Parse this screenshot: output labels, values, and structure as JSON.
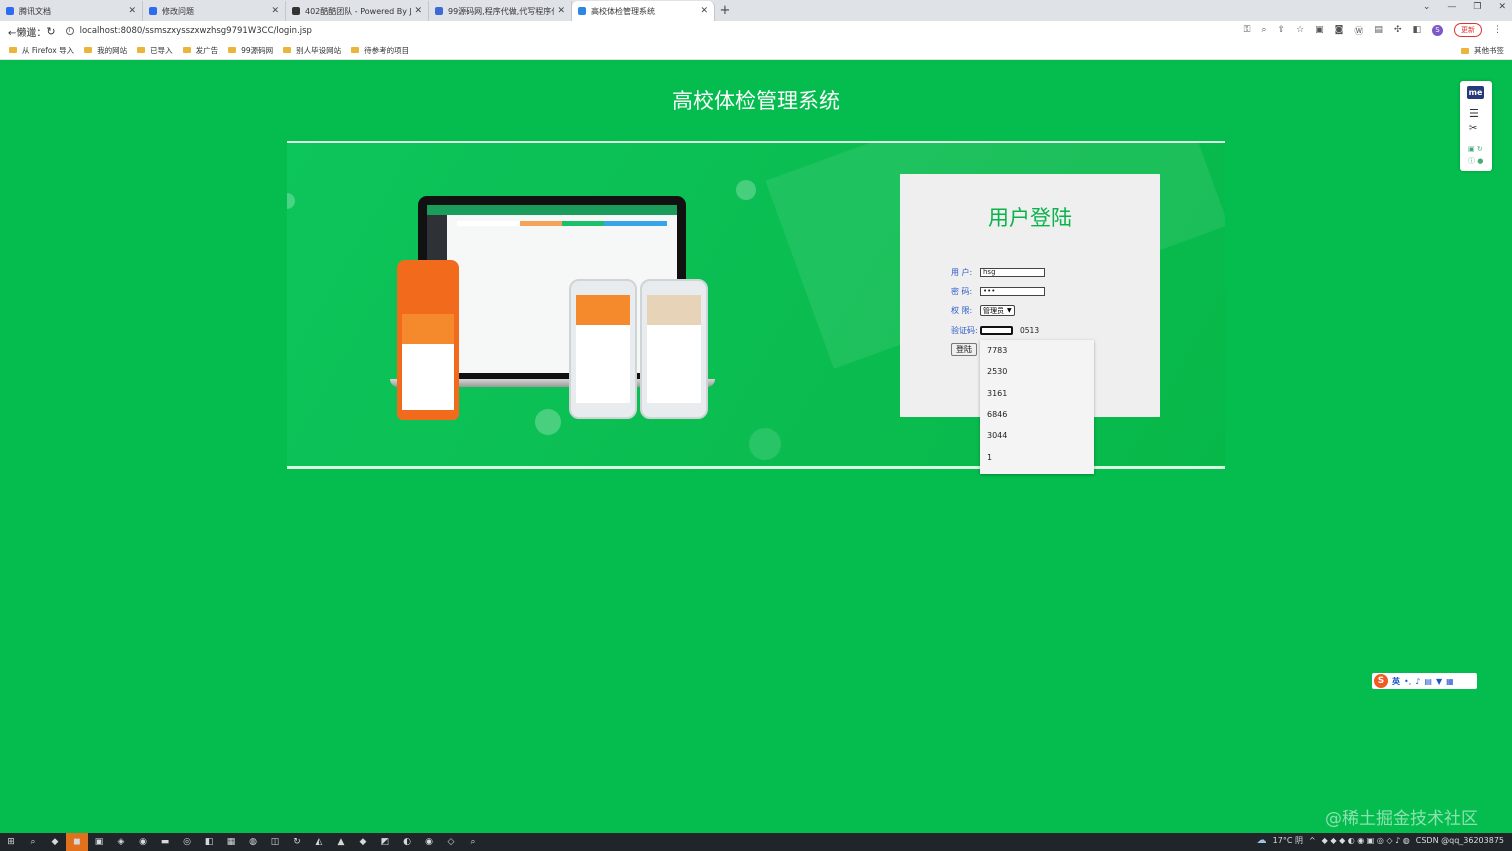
{
  "browser": {
    "tabs": [
      {
        "title": "腾讯文档",
        "favicon_color": "#2d6cf0",
        "active": false
      },
      {
        "title": "修改问题",
        "favicon_color": "#2d6cf0",
        "active": false
      },
      {
        "title": "402酷酷团队 - Powered By J2eeF",
        "favicon_color": "#333333",
        "active": false
      },
      {
        "title": "99源码网,程序代做,代写程序代做",
        "favicon_color": "#3a6bd6",
        "active": false
      },
      {
        "title": "高校体检管理系统",
        "favicon_color": "#2b86e4",
        "active": true
      }
    ],
    "new_tab": "+",
    "window_controls": [
      "⌄",
      "—",
      "❐",
      "✕"
    ],
    "back_label": "←懒邋：",
    "url": "localhost:8080/ssmszxysszxwzhsg9791W3CC/login.jsp",
    "profile_initial": "S",
    "update_label": "更新",
    "bookmarks": [
      "从 Firefox 导入",
      "我的网站",
      "已导入",
      "发广告",
      "99源码网",
      "别人毕设网站",
      "待参考的项目"
    ],
    "other_bookmarks": "其他书签"
  },
  "page": {
    "title": "高校体检管理系统"
  },
  "login": {
    "title": "用户登陆",
    "user_label": "用 户:",
    "user_value": "hsg",
    "password_label": "密 码:",
    "password_value": "•••",
    "role_label": "权 限:",
    "role_value": "管理员",
    "captcha_label": "验证码:",
    "captcha_code": "0513",
    "submit_label": "登陆",
    "autocomplete_options": [
      "7783",
      "2530",
      "3161",
      "6846",
      "3044",
      "1"
    ]
  },
  "side_widget": {
    "logo": "me"
  },
  "ime": {
    "logo": "S",
    "mode": "英"
  },
  "watermark": "@稀土掘金技术社区",
  "taskbar": {
    "weather": "17°C 阴",
    "tray_text": "CSDN @qq_36203875"
  },
  "colors": {
    "page_bg": "#04bd4e",
    "title_accent": "#09b34b",
    "label_blue": "#2a59c8"
  }
}
